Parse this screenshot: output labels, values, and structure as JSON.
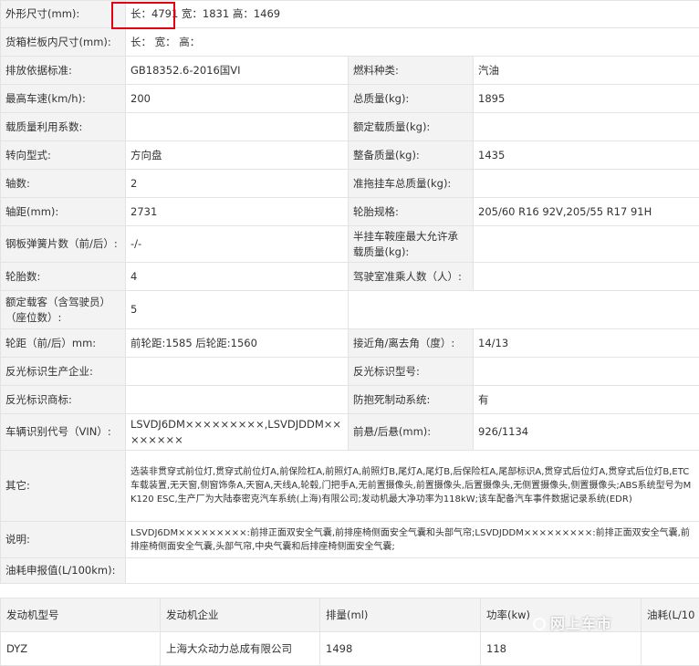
{
  "spec_rows": [
    {
      "k1": "外形尺寸(mm):",
      "v1": "长：4791 宽：1831 高：1469"
    },
    {
      "k1": "货箱栏板内尺寸(mm):",
      "v1": "长：  宽：  高："
    },
    {
      "k1": "排放依据标准:",
      "v1": "GB18352.6-2016国VI",
      "k2": "燃料种类:",
      "v2": "汽油"
    },
    {
      "k1": "最高车速(km/h):",
      "v1": "200",
      "k2": "总质量(kg):",
      "v2": "1895"
    },
    {
      "k1": "载质量利用系数:",
      "v1": "",
      "k2": "额定载质量(kg):",
      "v2": ""
    },
    {
      "k1": "转向型式:",
      "v1": "方向盘",
      "k2": "整备质量(kg):",
      "v2": "1435"
    },
    {
      "k1": "轴数:",
      "v1": "2",
      "k2": "准拖挂车总质量(kg):",
      "v2": ""
    },
    {
      "k1": "轴距(mm):",
      "v1": "2731",
      "k2": "轮胎规格:",
      "v2": "205/60 R16 92V,205/55 R17 91H"
    },
    {
      "k1": "钢板弹簧片数（前/后）:",
      "v1": "-/-",
      "k2": "半挂车鞍座最大允许承载质量(kg):",
      "v2": ""
    },
    {
      "k1": "轮胎数:",
      "v1": "4",
      "k2": "驾驶室准乘人数（人）:",
      "v2": ""
    },
    {
      "k1": "额定载客（含驾驶员）（座位数）:",
      "v1": "5"
    },
    {
      "k1": "轮距（前/后）mm:",
      "v1": "前轮距:1585 后轮距:1560",
      "k2": "接近角/离去角（度）:",
      "v2": "14/13"
    },
    {
      "k1": "反光标识生产企业:",
      "v1": "",
      "k2": "反光标识型号:",
      "v2": ""
    },
    {
      "k1": "反光标识商标:",
      "v1": "",
      "k2": "防抱死制动系统:",
      "v2": "有"
    },
    {
      "k1": "车辆识别代号（VIN）:",
      "v1": "LSVDJ6DM×××××××××,LSVDJDDM××××××××",
      "k2": "前悬/后悬(mm):",
      "v2": "926/1134"
    },
    {
      "k1": "其它:",
      "v1": "选装非贯穿式前位灯,贯穿式前位灯A,前保险杠A,前照灯A,前照灯B,尾灯A,尾灯B,后保险杠A,尾部标识A,贯穿式后位灯A,贯穿式后位灯B,ETC车载装置,无天窗,侧窗饰条A,天窗A,天线A,轮毂,门把手A,无前置摄像头,前置摄像头,后置摄像头,无侧置摄像头,侧置摄像头;ABS系统型号为MK120 ESC,生产厂为大陆泰密克汽车系统(上海)有限公司;发动机最大净功率为118kW;该车配备汽车事件数据记录系统(EDR)"
    },
    {
      "k1": "说明:",
      "v1": "LSVDJ6DM×××××××××:前排正面双安全气囊,前排座椅侧面安全气囊和头部气帘;LSVDJDDM×××××××××:前排正面双安全气囊,前排座椅侧面安全气囊,头部气帘,中央气囊和后排座椅侧面安全气囊;"
    },
    {
      "k1": "油耗申报值(L/100km):",
      "v1": ""
    }
  ],
  "engine_table": {
    "headers": [
      "发动机型号",
      "发动机企业",
      "排量(ml)",
      "功率(kw)",
      "油耗(L/10"
    ],
    "row": [
      "DYZ",
      "上海大众动力总成有限公司",
      "1498",
      "118",
      ""
    ]
  },
  "watermark": "网上车市"
}
